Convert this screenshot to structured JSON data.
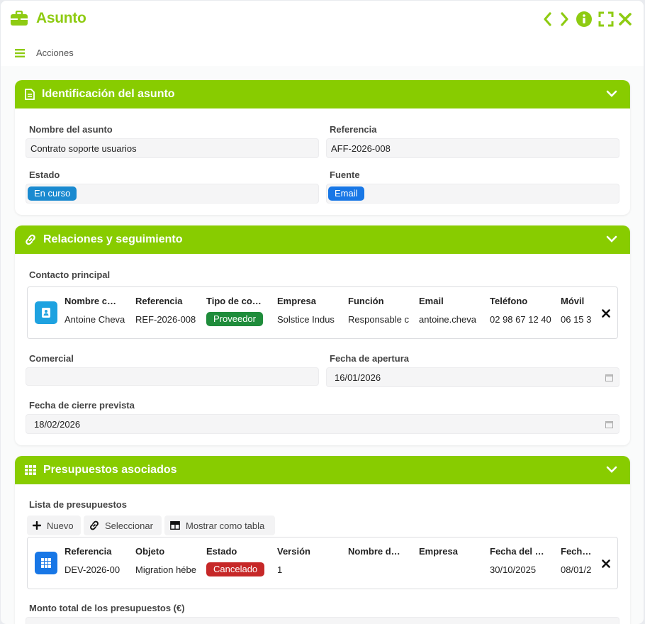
{
  "window": {
    "title": "Asunto",
    "actions_label": "Acciones",
    "accent_color": "#88cc00"
  },
  "identificacion": {
    "title": "Identificación del asunto",
    "nombre_label": "Nombre del asunto",
    "nombre_value": "Contrato soporte usuarios",
    "referencia_label": "Referencia",
    "referencia_value": "AFF-2026-008",
    "estado_label": "Estado",
    "estado_value": "En curso",
    "estado_color": "#1a8ad0",
    "fuente_label": "Fuente",
    "fuente_value": "Email",
    "fuente_color": "#1877e6"
  },
  "relaciones": {
    "title": "Relaciones y seguimiento",
    "contacto_label": "Contacto principal",
    "contacto_columns": [
      {
        "header": "Nombre c…",
        "value": "Antoine Cheva"
      },
      {
        "header": "Referencia",
        "value": "REF-2026-008"
      },
      {
        "header": "Tipo de co…",
        "value": "Proveedor"
      },
      {
        "header": "Empresa",
        "value": "Solstice Indus"
      },
      {
        "header": "Función",
        "value": "Responsable c"
      },
      {
        "header": "Email",
        "value": "antoine.cheva"
      },
      {
        "header": "Teléfono",
        "value": "02 98 67 12 40"
      },
      {
        "header": "Móvil",
        "value": "06 15 3"
      }
    ],
    "proveedor_color": "#1f8c3b",
    "comercial_label": "Comercial",
    "comercial_value": "",
    "apertura_label": "Fecha de apertura",
    "apertura_value": "16/01/2026",
    "cierre_label": "Fecha de cierre prevista",
    "cierre_value": "18/02/2026"
  },
  "presupuestos": {
    "title": "Presupuestos asociados",
    "lista_label": "Lista de presupuestos",
    "toolbar": {
      "nuevo": "Nuevo",
      "seleccionar": "Seleccionar",
      "mostrar": "Mostrar como tabla"
    },
    "columns": [
      {
        "header": "Referencia",
        "value": "DEV-2026-00"
      },
      {
        "header": "Objeto",
        "value": "Migration hébe"
      },
      {
        "header": "Estado",
        "value": "Cancelado"
      },
      {
        "header": "Versión",
        "value": "1"
      },
      {
        "header": "Nombre d…",
        "value": ""
      },
      {
        "header": "Empresa",
        "value": ""
      },
      {
        "header": "Fecha del …",
        "value": "30/10/2025"
      },
      {
        "header": "Fecha c",
        "value": "08/01/2"
      }
    ],
    "cancelado_color": "#c62828",
    "monto_label": "Monto total de los presupuestos (€)"
  }
}
